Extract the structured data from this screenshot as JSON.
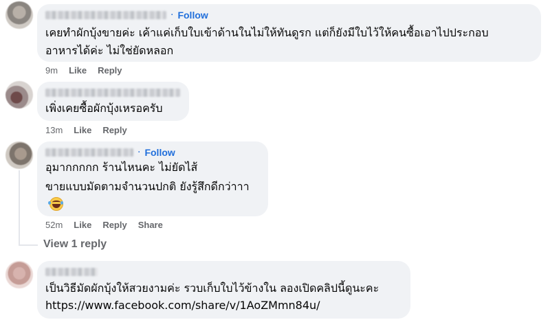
{
  "colors": {
    "bubble": "#f0f2f5",
    "follow": "#216fdb",
    "meta": "#65676b",
    "text": "#050505"
  },
  "comments": [
    {
      "follow_label": "Follow",
      "lines": [
        "เคยทำผักบุ้งขายค่ะ เค้าแค่เก็บใบเข้าด้านในไม่ให้ทันดูรก แต่ก็ยังมีใบไว้ให้คนซื้อเอาไปประกอบ",
        "อาหารได้ค่ะ ไม่ใช่ยัดหลอก"
      ],
      "time": "9m",
      "like": "Like",
      "reply": "Reply"
    },
    {
      "lines": [
        "เพิ่งเคยซื้อผักบุ้งเหรอครับ"
      ],
      "time": "13m",
      "like": "Like",
      "reply": "Reply"
    },
    {
      "follow_label": "Follow",
      "lines": [
        "อุมากกกกก ร้านไหนคะ ไม่ยัดไส้",
        "ขายแบบมัดตามจำนวนปกติ ยังรู้สึกดีกว่าาา"
      ],
      "emoji": "laughing-tears",
      "time": "52m",
      "like": "Like",
      "reply": "Reply",
      "share": "Share"
    },
    {
      "lines": [
        "เป็นวิธีมัดผักบุ้งให้สวยงามค่ะ รวบเก็บใบไว้ข้างใน ลองเปิดคลิปนี้ดูนะคะ",
        "https://www.facebook.com/share/v/1AoZMmn84u/"
      ]
    }
  ],
  "view_reply": "View 1 reply"
}
